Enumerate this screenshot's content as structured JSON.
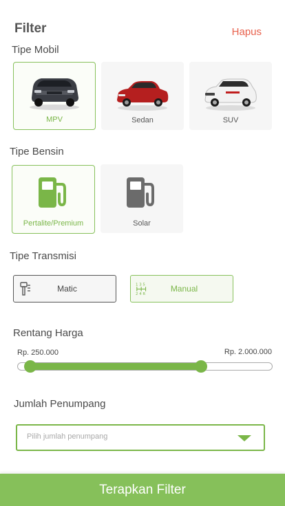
{
  "header": {
    "title": "Filter",
    "reset_label": "Hapus"
  },
  "car_type": {
    "label": "Tipe Mobil",
    "options": [
      {
        "label": "MPV",
        "selected": true
      },
      {
        "label": "Sedan",
        "selected": false
      },
      {
        "label": "SUV",
        "selected": false
      }
    ]
  },
  "fuel_type": {
    "label": "Tipe Bensin",
    "options": [
      {
        "label": "Pertalite/Premium",
        "selected": true,
        "icon": "fuel-pump-icon"
      },
      {
        "label": "Solar",
        "selected": false,
        "icon": "fuel-pump-icon"
      }
    ]
  },
  "transmission": {
    "label": "Tipe Transmisi",
    "options": [
      {
        "label": "Matic",
        "selected": false,
        "icon": "automatic-gear-icon"
      },
      {
        "label": "Manual",
        "selected": true,
        "icon": "manual-gear-icon"
      }
    ]
  },
  "price_range": {
    "label": "Rentang Harga",
    "min_label": "Rp. 250.000",
    "max_label": "Rp. 2.000.000",
    "selected_low_fraction": 0.05,
    "selected_high_fraction": 0.72
  },
  "passengers": {
    "label": "Jumlah Penumpang",
    "placeholder": "Pilih jumlah penumpang"
  },
  "apply_label": "Terapkan Filter",
  "colors": {
    "accent": "#7ab648",
    "reset": "#e8604c",
    "icon_gray": "#6b6b6b"
  }
}
